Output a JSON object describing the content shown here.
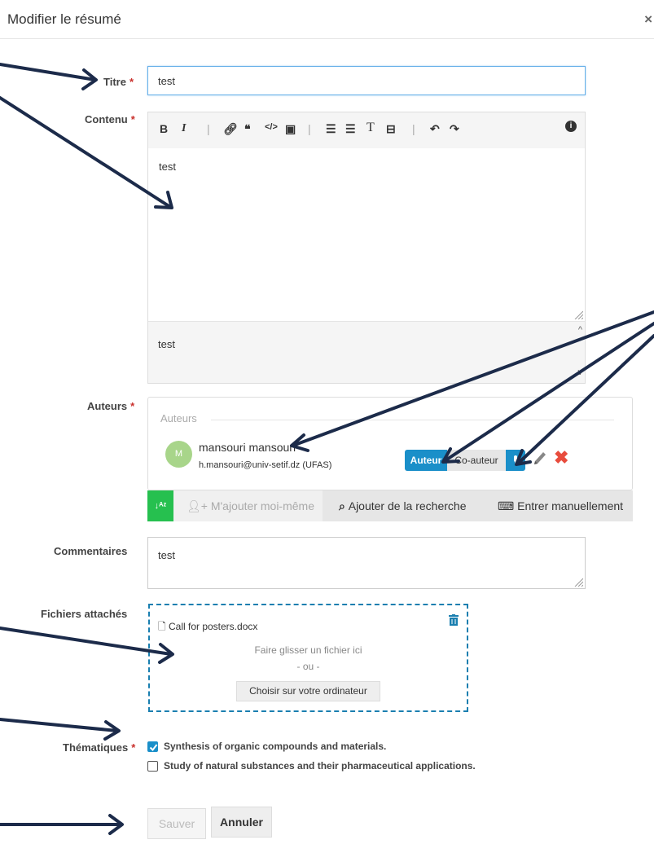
{
  "modal": {
    "title": "Modifier le résumé",
    "close": "×"
  },
  "required_mark": "*",
  "fields": {
    "title": {
      "label": "Titre",
      "value": "test"
    },
    "content": {
      "label": "Contenu",
      "value": "test",
      "source_value": "test"
    },
    "authors": {
      "label": "Auteurs"
    },
    "comments": {
      "label": "Commentaires",
      "value": "test"
    },
    "attachments": {
      "label": "Fichiers attachés"
    },
    "themes": {
      "label": "Thématiques"
    }
  },
  "authors_box": {
    "legend": "Auteurs",
    "items": [
      {
        "initial": "M",
        "name": "mansouri mansouri",
        "email": "h.mansouri@univ-setif.dz (UFAS)",
        "role_active": "Auteur",
        "role_other": "Co-auteur"
      }
    ],
    "actions": {
      "sort": "↓ᴬᶻ",
      "add_me": "M'ajouter moi-même",
      "add_search": "Ajouter de la recherche",
      "enter_manual": "Entrer manuellement"
    }
  },
  "dropzone": {
    "file_name": "Call for posters.docx",
    "drop_text": "Faire glisser un fichier ici",
    "or_text": "- ou -",
    "choose_label": "Choisir sur votre ordinateur"
  },
  "themes": [
    {
      "label": "Synthesis of organic compounds and materials.",
      "checked": true
    },
    {
      "label": "Study of natural substances and their pharmaceutical applications.",
      "checked": false
    }
  ],
  "buttons": {
    "save": "Sauver",
    "cancel": "Annuler"
  },
  "colors": {
    "accent": "#1a8fc9",
    "danger": "#e84c3d",
    "success": "#26c04f",
    "required": "#c9302c",
    "arrow": "#1c2b4a"
  }
}
